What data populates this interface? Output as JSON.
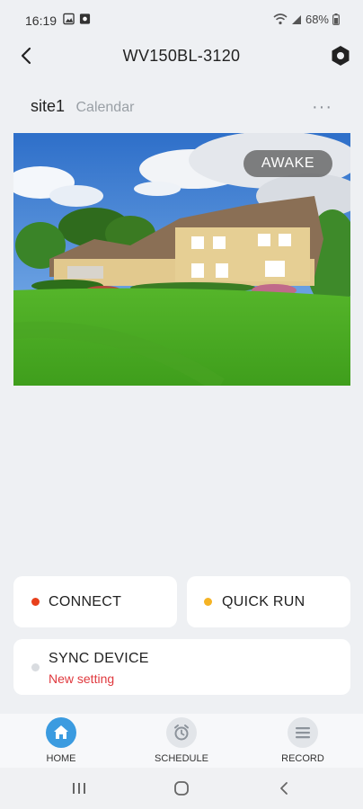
{
  "status_bar": {
    "time": "16:19",
    "battery": "68%"
  },
  "header": {
    "title": "WV150BL-3120"
  },
  "site": {
    "name": "site1",
    "calendar_label": "Calendar",
    "more": "···"
  },
  "camera": {
    "status_badge": "AWAKE"
  },
  "actions": {
    "connect": {
      "label": "CONNECT",
      "color": "#e8401c"
    },
    "quick_run": {
      "label": "QUICK RUN",
      "color": "#f5b324"
    },
    "sync": {
      "label": "SYNC DEVICE",
      "sub": "New setting",
      "color": "#d9dce0"
    }
  },
  "nav": {
    "home": "HOME",
    "schedule": "SCHEDULE",
    "record": "RECORD"
  },
  "colors": {
    "accent": "#3b9be0",
    "alert_text": "#e0393e"
  }
}
